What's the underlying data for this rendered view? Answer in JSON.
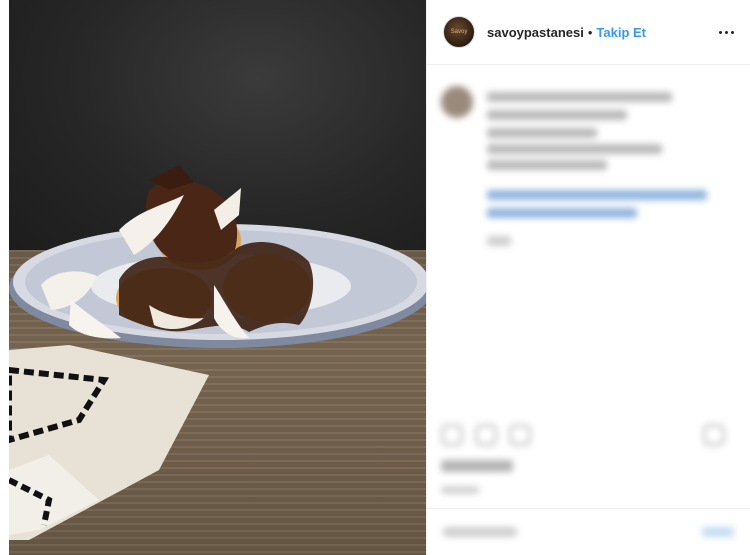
{
  "header": {
    "username": "savoypastanesi",
    "separator": "•",
    "follow_label": "Takip Et",
    "avatar_text": "Savoy"
  },
  "photo": {
    "subject": "profiterole dessert with chocolate sauce and white chocolate shavings"
  },
  "colors": {
    "follow_blue": "#3897f0",
    "text": "#262626",
    "divider": "#efefef"
  },
  "icons": [
    "more-options-icon",
    "heart-icon",
    "comment-icon",
    "share-icon",
    "bookmark-icon"
  ]
}
